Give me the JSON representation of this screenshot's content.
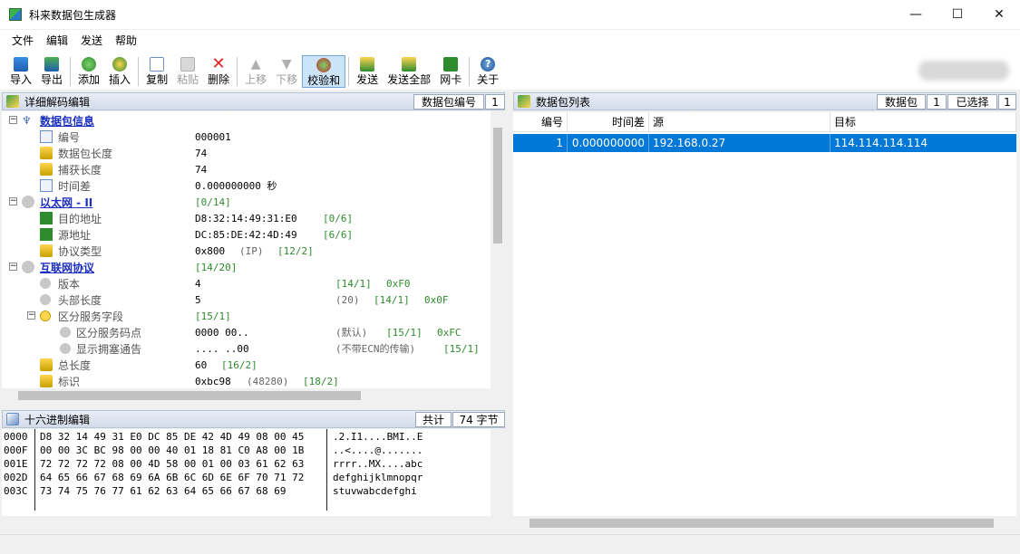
{
  "window": {
    "title": "科来数据包生成器",
    "minimize": "—",
    "maximize": "☐",
    "close": "✕"
  },
  "menu": [
    "文件",
    "编辑",
    "发送",
    "帮助"
  ],
  "toolbar": {
    "import": "导入",
    "export": "导出",
    "add": "添加",
    "insert": "插入",
    "copy": "复制",
    "paste": "粘贴",
    "delete": "删除",
    "up": "上移",
    "down": "下移",
    "checksum": "校验和",
    "send": "发送",
    "send_all": "发送全部",
    "nic": "网卡",
    "about": "关于"
  },
  "decode_panel": {
    "title": "详细解码编辑",
    "label": "数据包编号",
    "value": "1"
  },
  "tree": [
    {
      "name": "数据包信息",
      "value": ""
    },
    {
      "name": "编号",
      "value": "000001"
    },
    {
      "name": "数据包长度",
      "value": "74"
    },
    {
      "name": "捕获长度",
      "value": "74"
    },
    {
      "name": "时间差",
      "value": "0.000000000 秒"
    },
    {
      "name": "以太网 - II",
      "value": "",
      "extra": "[0/14]"
    },
    {
      "name": "目的地址",
      "value": "D8:32:14:49:31:E0",
      "extra": "[0/6]"
    },
    {
      "name": "源地址",
      "value": "DC:85:DE:42:4D:49",
      "extra": "[6/6]"
    },
    {
      "name": "协议类型",
      "value": "0x800",
      "note": "(IP)",
      "extra": "[12/2]"
    },
    {
      "name": "互联网协议",
      "value": "",
      "extra": "[14/20]"
    },
    {
      "name": "版本",
      "value": "4",
      "extra": "[14/1]",
      "extra2": "0xF0"
    },
    {
      "name": "头部长度",
      "value": "5",
      "note": "(20)",
      "extra": "[14/1]",
      "extra2": "0x0F"
    },
    {
      "name": "区分服务字段",
      "value": "",
      "extra": "[15/1]"
    },
    {
      "name": "区分服务码点",
      "value": "0000 00..",
      "note": "(默认)",
      "extra": "[15/1]",
      "extra2": "0xFC"
    },
    {
      "name": "显示拥塞通告",
      "value": ".... ..00",
      "note": "(不带ECN的传输)",
      "extra": "[15/1]"
    },
    {
      "name": "总长度",
      "value": "60",
      "extra": "[16/2]"
    },
    {
      "name": "标识",
      "value": "0xbc98",
      "note": "(48280)",
      "extra": "[18/2]"
    }
  ],
  "hex_panel": {
    "title": "十六进制编辑",
    "label": "共计",
    "value": "74 字节"
  },
  "hex": [
    {
      "off": "0000",
      "bytes": "D8 32 14 49 31 E0 DC 85 DE 42 4D 49 08 00 45",
      "ascii": ".2.I1....BMI..E"
    },
    {
      "off": "000F",
      "bytes": "00 00 3C BC 98 00 00 40 01 18 81 C0 A8 00 1B",
      "ascii": "..<....@......."
    },
    {
      "off": "001E",
      "bytes": "72 72 72 72 08 00 4D 58 00 01 00 03 61 62 63",
      "ascii": "rrrr..MX....abc"
    },
    {
      "off": "002D",
      "bytes": "64 65 66 67 68 69 6A 6B 6C 6D 6E 6F 70 71 72",
      "ascii": "defghijklmnopqr"
    },
    {
      "off": "003C",
      "bytes": "73 74 75 76 77 61 62 63 64 65 66 67 68 69",
      "ascii": "stuvwabcdefghi"
    }
  ],
  "list_panel": {
    "title": "数据包列表",
    "label1": "数据包",
    "value1": "1",
    "label2": "已选择",
    "value2": "1"
  },
  "list_columns": [
    "编号",
    "时间差",
    "源",
    "目标"
  ],
  "list_rows": [
    {
      "no": "1",
      "delta": "0.000000000",
      "src": "192.168.0.27",
      "dst": "114.114.114.114"
    }
  ]
}
